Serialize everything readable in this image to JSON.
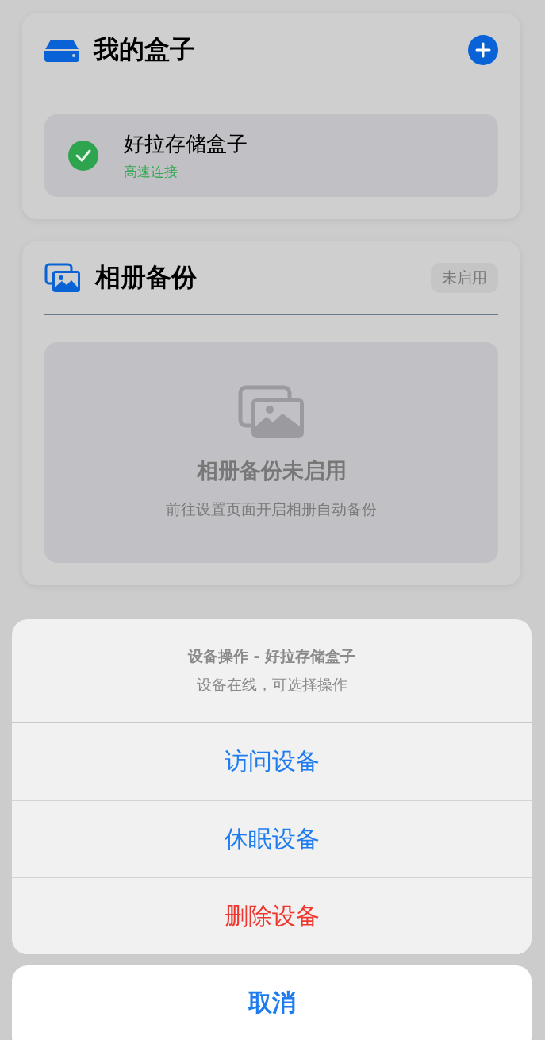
{
  "my_box": {
    "title": "我的盒子",
    "devices": [
      {
        "name": "好拉存储盒子",
        "status": "高速连接",
        "online": true
      }
    ]
  },
  "album_backup": {
    "title": "相册备份",
    "badge": "未启用",
    "empty_title": "相册备份未启用",
    "empty_hint": "前往设置页面开启相册自动备份"
  },
  "action_sheet": {
    "title": "设备操作 - 好拉存储盒子",
    "message": "设备在线，可选择操作",
    "actions": [
      {
        "label": "访问设备",
        "kind": "default"
      },
      {
        "label": "休眠设备",
        "kind": "default"
      },
      {
        "label": "删除设备",
        "kind": "destructive"
      }
    ],
    "cancel": "取消"
  }
}
